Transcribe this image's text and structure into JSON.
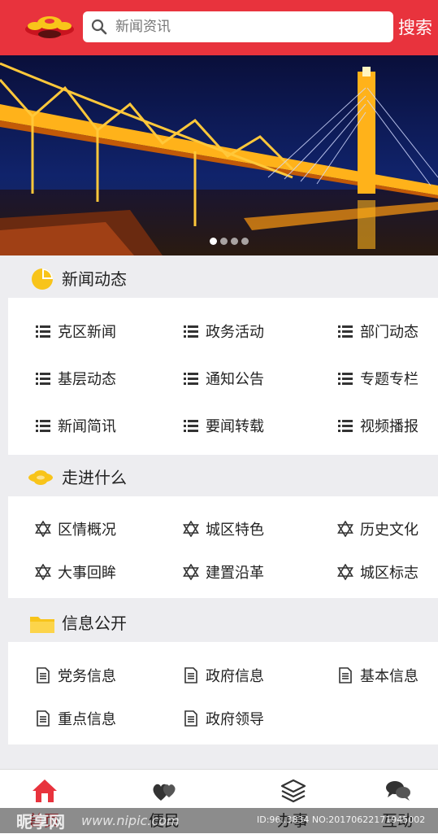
{
  "header": {
    "search_placeholder": "新闻资讯",
    "search_button": "搜索"
  },
  "banner": {
    "dot_count": 4,
    "active_dot": 0
  },
  "sections": {
    "news": {
      "title": "新闻动态",
      "items": [
        "克区新闻",
        "政务活动",
        "部门动态",
        "基层动态",
        "通知公告",
        "专题专栏",
        "新闻简讯",
        "要闻转载",
        "视频播报"
      ]
    },
    "about": {
      "title": "走进什么",
      "items": [
        "区情概况",
        "城区特色",
        "历史文化",
        "大事回眸",
        "建置沿革",
        "城区标志"
      ]
    },
    "info": {
      "title": "信息公开",
      "items": [
        "党务信息",
        "政府信息",
        "基本信息",
        "重点信息",
        "政府领导"
      ]
    }
  },
  "tabbar": {
    "tabs": [
      "首页",
      "便民",
      "办事",
      "互动"
    ],
    "active": 0
  },
  "watermark": {
    "brand": "昵享网",
    "url": "www.nipic.com",
    "id": "ID:96..3834 NO:20170622171945002"
  },
  "colors": {
    "brand_red": "#e8333d",
    "accent_yellow": "#f8c41a"
  }
}
